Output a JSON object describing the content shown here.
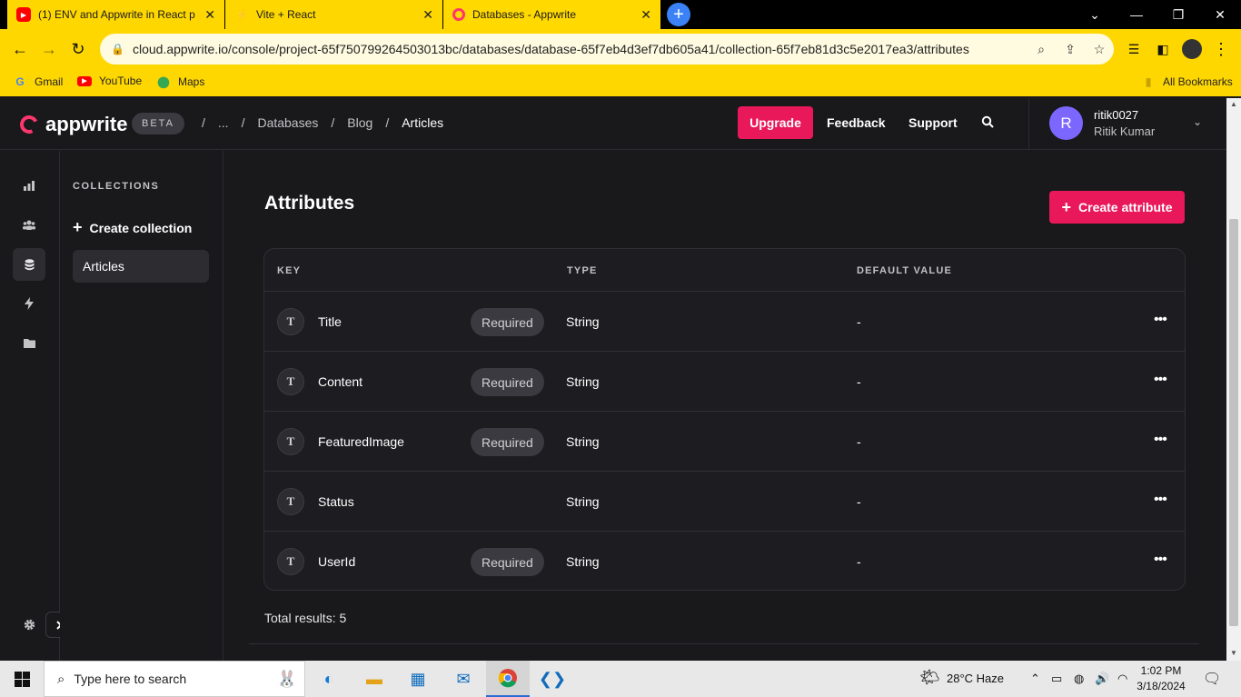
{
  "browser": {
    "tabs": [
      {
        "title": "(1) ENV and Appwrite in React p",
        "icon": "youtube-icon"
      },
      {
        "title": "Vite + React",
        "icon": "vite-icon"
      },
      {
        "title": "Databases - Appwrite",
        "icon": "appwrite-icon"
      }
    ],
    "url": "cloud.appwrite.io/console/project-65f750799264503013bc/databases/database-65f7eb4d3ef7db605a41/collection-65f7eb81d3c5e2017ea3/attributes",
    "bookmarks": [
      {
        "label": "Gmail",
        "icon": "google-icon"
      },
      {
        "label": "YouTube",
        "icon": "youtube-icon"
      },
      {
        "label": "Maps",
        "icon": "maps-icon"
      }
    ],
    "all_bookmarks": "All Bookmarks"
  },
  "header": {
    "brand": "appwrite",
    "badge": "BETA",
    "breadcrumbs": [
      "...",
      "Databases",
      "Blog",
      "Articles"
    ],
    "upgrade": "Upgrade",
    "feedback": "Feedback",
    "support": "Support",
    "user": {
      "initial": "R",
      "username": "ritik0027",
      "fullname": "Ritik Kumar"
    }
  },
  "collections": {
    "title": "COLLECTIONS",
    "create": "Create collection",
    "items": [
      "Articles"
    ]
  },
  "main": {
    "title": "Attributes",
    "create_button": "Create attribute",
    "columns": {
      "key": "KEY",
      "type": "TYPE",
      "default": "DEFAULT VALUE"
    },
    "rows": [
      {
        "icon": "T",
        "key": "Title",
        "required": "Required",
        "type": "String",
        "default": "-"
      },
      {
        "icon": "T",
        "key": "Content",
        "required": "Required",
        "type": "String",
        "default": "-"
      },
      {
        "icon": "T",
        "key": "FeaturedImage",
        "required": "Required",
        "type": "String",
        "default": "-"
      },
      {
        "icon": "T",
        "key": "Status",
        "required": "",
        "type": "String",
        "default": "-"
      },
      {
        "icon": "T",
        "key": "UserId",
        "required": "Required",
        "type": "String",
        "default": "-"
      }
    ],
    "total": "Total results: 5"
  },
  "taskbar": {
    "search_placeholder": "Type here to search",
    "weather": "28°C  Haze",
    "time": "1:02 PM",
    "date": "3/18/2024"
  },
  "colors": {
    "accent": "#e8185a",
    "avatar": "#7c67fe",
    "chrome": "#ffd700"
  }
}
